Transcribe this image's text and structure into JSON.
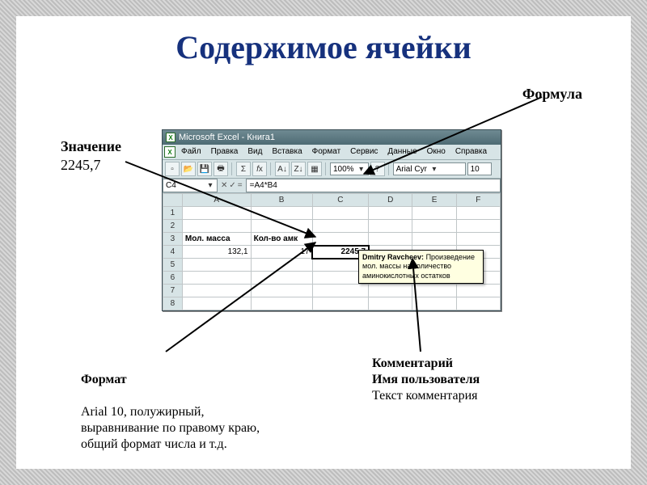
{
  "title": "Содержимое ячейки",
  "labels": {
    "formula": "Формула",
    "value_title": "Значение",
    "value_text": "2245,7",
    "format_title": "Формат",
    "format_text": "Arial 10, полужирный,\n выравнивание по правому краю,\nобщий формат числа и т.д.",
    "comment_title": "Комментарий",
    "comment_l2": "Имя пользователя",
    "comment_l3": "Текст комментария"
  },
  "excel": {
    "title": "Microsoft Excel - Книга1",
    "menus": [
      "Файл",
      "Правка",
      "Вид",
      "Вставка",
      "Формат",
      "Сервис",
      "Данные",
      "Окно",
      "Справка"
    ],
    "zoom": "100%",
    "font": "Arial Cyr",
    "fontsize": "10",
    "namebox": "C4",
    "formula": "=A4*B4",
    "cols": [
      "A",
      "B",
      "C",
      "D",
      "E",
      "F"
    ],
    "rows": [
      "1",
      "2",
      "3",
      "4",
      "5",
      "6",
      "7",
      "8"
    ],
    "cells": {
      "A3": "Мол. масса",
      "B3": "Кол-во амк",
      "A4": "132,1",
      "B4": "17",
      "C4": "2245,7"
    },
    "comment": {
      "author": "Dmitry Ravcheev:",
      "text": "Произведение мол. массы на количество аминокислотных остатков"
    }
  }
}
